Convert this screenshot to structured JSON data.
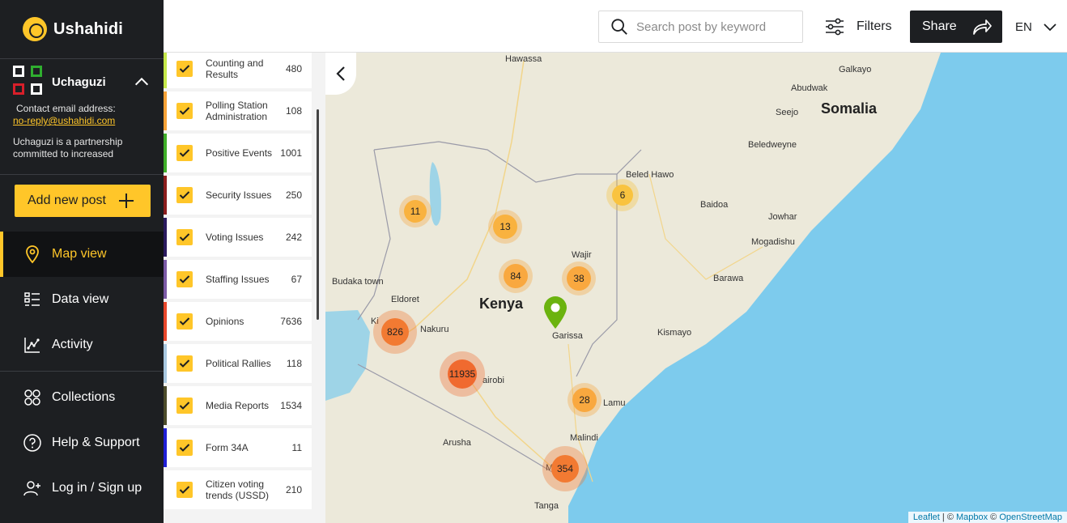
{
  "brand": {
    "name": "Ushahidi"
  },
  "deployment": {
    "name": "Uchaguzi",
    "contact_label": "Contact email address:",
    "contact_email": "no-reply@ushahidi.com",
    "description": "Uchaguzi is a partnership committed to increased"
  },
  "add_post": {
    "label": "Add new post"
  },
  "nav": {
    "map": "Map view",
    "data": "Data view",
    "activity": "Activity",
    "collections": "Collections",
    "help": "Help & Support",
    "login": "Log in / Sign up"
  },
  "topbar": {
    "search_placeholder": "Search post by keyword",
    "filters": "Filters",
    "share": "Share",
    "lang": "EN"
  },
  "categories": [
    {
      "label": "Counting and Results",
      "count": "480",
      "color": "#c5e84a"
    },
    {
      "label": "Polling Station Administration",
      "count": "108",
      "color": "#f7a238"
    },
    {
      "label": "Positive Events",
      "count": "1001",
      "color": "#3fae29"
    },
    {
      "label": "Security Issues",
      "count": "250",
      "color": "#8b1d1d"
    },
    {
      "label": "Voting Issues",
      "count": "242",
      "color": "#2a1a5e"
    },
    {
      "label": "Staffing Issues",
      "count": "67",
      "color": "#7b5aa6"
    },
    {
      "label": "Opinions",
      "count": "7636",
      "color": "#e8472b"
    },
    {
      "label": "Political Rallies",
      "count": "118",
      "color": "#a9c8e0"
    },
    {
      "label": "Media Reports",
      "count": "1534",
      "color": "#4b4b2a"
    },
    {
      "label": "Form 34A",
      "count": "11",
      "color": "#1f1fd6"
    },
    {
      "label": "Citizen voting trends (USSD)",
      "count": "210",
      "color": "#ffffff"
    }
  ],
  "map": {
    "places": {
      "hawassa": "Hawassa",
      "galkayo": "Galkayo",
      "abudwak": "Abudwak",
      "seejo": "Seejo",
      "beledweyne": "Beledweyne",
      "beled_hawo": "Beled Hawo",
      "baidoa": "Baidoa",
      "jowhar": "Jowhar",
      "mogadishu": "Mogadishu",
      "wajir": "Wajir",
      "baraawa": "Barawa",
      "budaka": "Budaka town",
      "eldoret": "Eldoret",
      "nakuru": "Nakuru",
      "garissa": "Garissa",
      "kismayo": "Kismayo",
      "nairobi": "airobi",
      "lamu": "Lamu",
      "malindi": "Malindi",
      "arusha": "Arusha",
      "mombasa": "M    asa",
      "tanga": "Tanga",
      "kisumu": "Ki"
    },
    "countries": {
      "kenya": "Kenya",
      "somalia": "Somalia"
    },
    "clusters": [
      "11",
      "13",
      "6",
      "84",
      "38",
      "826",
      "11935",
      "28",
      "354"
    ],
    "attribution": {
      "leaflet": "Leaflet",
      "sep1": " | © ",
      "mapbox": "Mapbox",
      "sep2": " © ",
      "osm": "OpenStreetMap"
    }
  }
}
